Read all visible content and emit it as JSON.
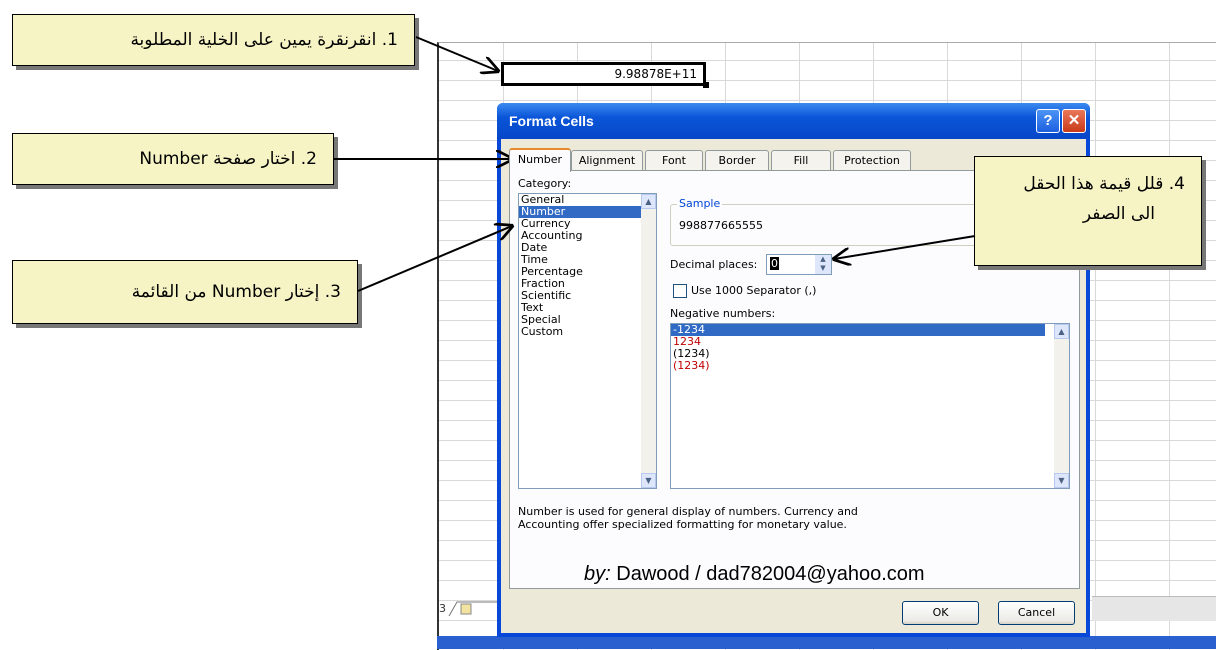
{
  "spreadsheet": {
    "selected_cell_value": "9.98878E+11"
  },
  "dialog": {
    "title": "Format Cells",
    "help_glyph": "?",
    "close_glyph": "✕",
    "tabs": [
      "Number",
      "Alignment",
      "Font",
      "Border",
      "Fill",
      "Protection"
    ],
    "active_tab": "Number",
    "category_label": "Category:",
    "categories": [
      "General",
      "Number",
      "Currency",
      "Accounting",
      "Date",
      "Time",
      "Percentage",
      "Fraction",
      "Scientific",
      "Text",
      "Special",
      "Custom"
    ],
    "selected_category": "Number",
    "sample_label": "Sample",
    "sample_value": "998877665555",
    "decimal_places_label": "Decimal places:",
    "decimal_places_value": "0",
    "separator_label": "Use 1000 Separator (,)",
    "separator_checked": false,
    "negative_numbers_label": "Negative numbers:",
    "negative_numbers": [
      "-1234",
      "1234",
      "(1234)",
      "(1234)"
    ],
    "negative_colors": [
      "#ffffff",
      "#c00000",
      "#000000",
      "#c00000"
    ],
    "selected_negative": "-1234",
    "description": "Number is used for general display of numbers.  Currency and Accounting offer specialized formatting for monetary value.",
    "credit_prefix": "by:",
    "credit_text": "Dawood / dad782004@yahoo.com",
    "ok_label": "OK",
    "cancel_label": "Cancel"
  },
  "callouts": {
    "step1": "1. انقرنقرة يمين على الخلية المطلوبة",
    "step2": "2. اختار صفحة Number",
    "step3": "3. إختار Number من القائمة",
    "step4_line1": "4. قلل قيمة هذا الحقل",
    "step4_line2": "الى الصفر"
  },
  "colors": {
    "callout_fill": "#f6f3c4",
    "title_bar": "#0a55d8",
    "selection": "#316ac5"
  }
}
